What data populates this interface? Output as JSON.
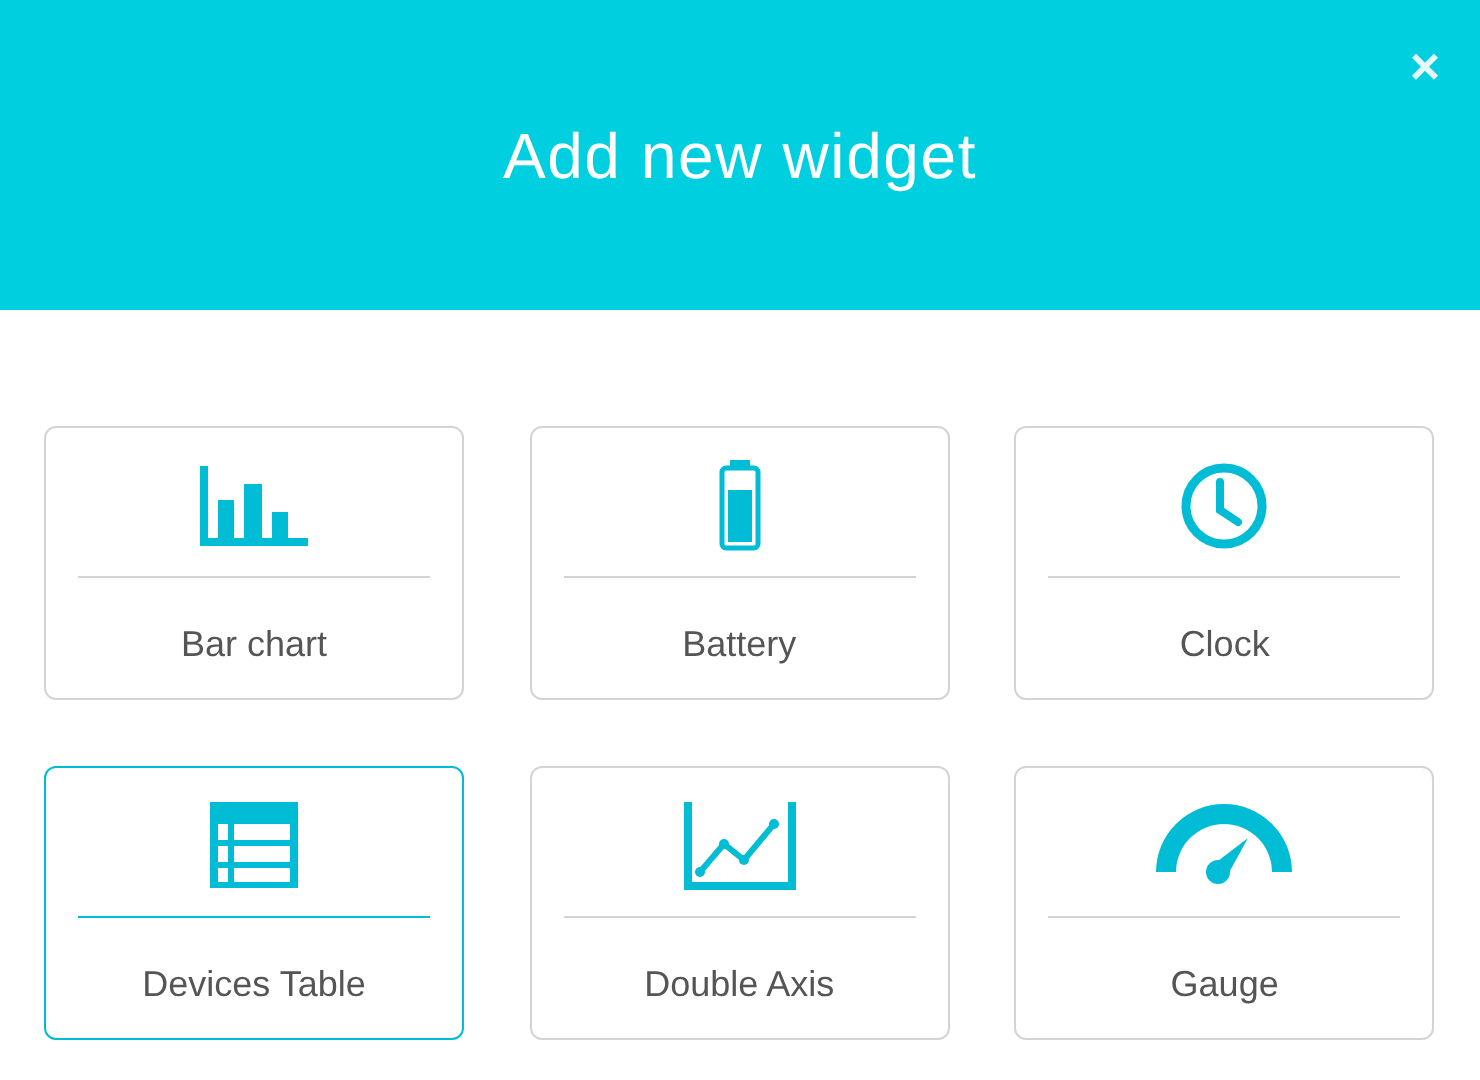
{
  "dialog": {
    "title": "Add new widget",
    "close": "×"
  },
  "widgets": [
    {
      "kind": "bar",
      "label": "Bar chart",
      "selected": false
    },
    {
      "kind": "battery",
      "label": "Battery",
      "selected": false
    },
    {
      "kind": "clock",
      "label": "Clock",
      "selected": false
    },
    {
      "kind": "table",
      "label": "Devices Table",
      "selected": true
    },
    {
      "kind": "axis",
      "label": "Double Axis",
      "selected": false
    },
    {
      "kind": "gauge",
      "label": "Gauge",
      "selected": false
    }
  ]
}
